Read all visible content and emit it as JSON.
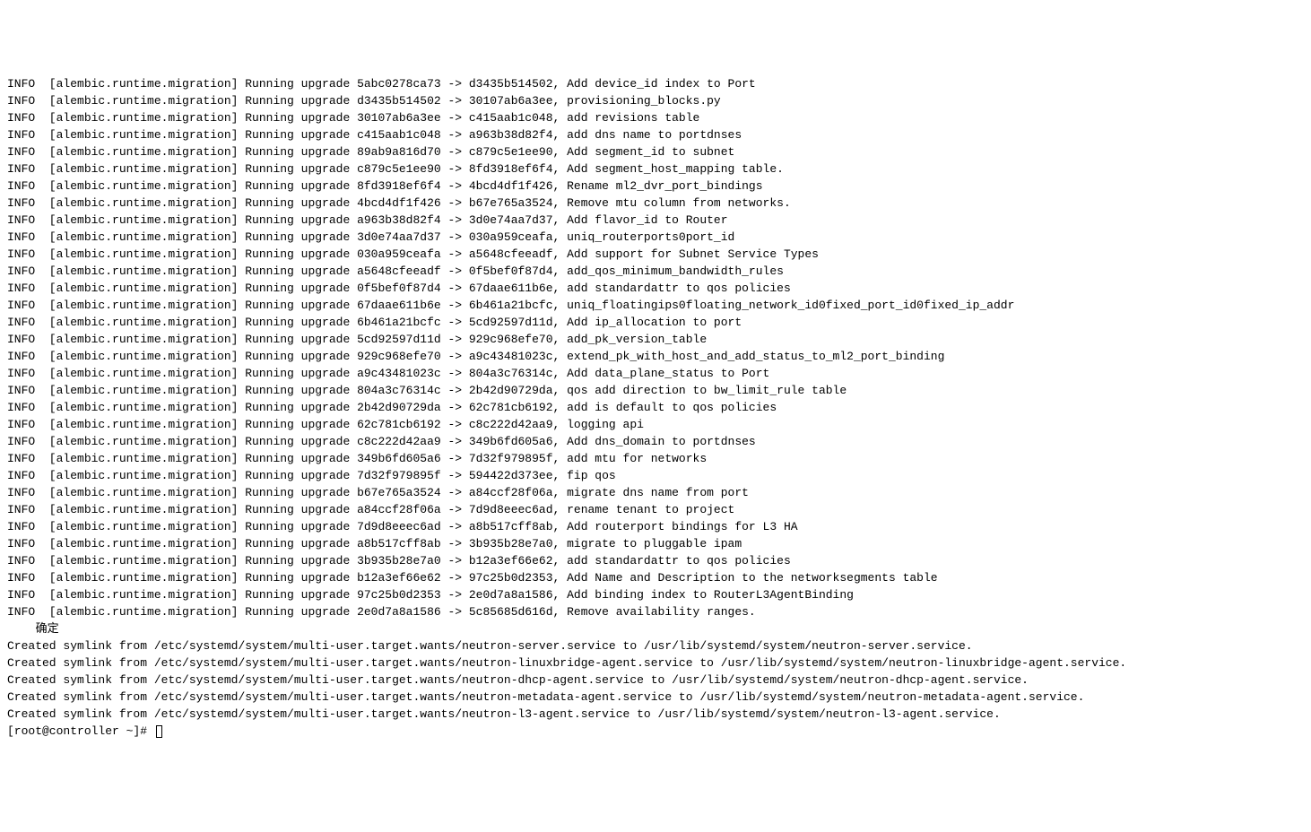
{
  "migrations": [
    {
      "from": "5abc0278ca73",
      "to": "d3435b514502",
      "desc": "Add device_id index to Port"
    },
    {
      "from": "d3435b514502",
      "to": "30107ab6a3ee",
      "desc": "provisioning_blocks.py"
    },
    {
      "from": "30107ab6a3ee",
      "to": "c415aab1c048",
      "desc": "add revisions table"
    },
    {
      "from": "c415aab1c048",
      "to": "a963b38d82f4",
      "desc": "add dns name to portdnses"
    },
    {
      "from": "89ab9a816d70",
      "to": "c879c5e1ee90",
      "desc": "Add segment_id to subnet"
    },
    {
      "from": "c879c5e1ee90",
      "to": "8fd3918ef6f4",
      "desc": "Add segment_host_mapping table."
    },
    {
      "from": "8fd3918ef6f4",
      "to": "4bcd4df1f426",
      "desc": "Rename ml2_dvr_port_bindings"
    },
    {
      "from": "4bcd4df1f426",
      "to": "b67e765a3524",
      "desc": "Remove mtu column from networks."
    },
    {
      "from": "a963b38d82f4",
      "to": "3d0e74aa7d37",
      "desc": "Add flavor_id to Router"
    },
    {
      "from": "3d0e74aa7d37",
      "to": "030a959ceafa",
      "desc": "uniq_routerports0port_id"
    },
    {
      "from": "030a959ceafa",
      "to": "a5648cfeeadf",
      "desc": "Add support for Subnet Service Types"
    },
    {
      "from": "a5648cfeeadf",
      "to": "0f5bef0f87d4",
      "desc": "add_qos_minimum_bandwidth_rules"
    },
    {
      "from": "0f5bef0f87d4",
      "to": "67daae611b6e",
      "desc": "add standardattr to qos policies"
    },
    {
      "from": "67daae611b6e",
      "to": "6b461a21bcfc",
      "desc": "uniq_floatingips0floating_network_id0fixed_port_id0fixed_ip_addr"
    },
    {
      "from": "6b461a21bcfc",
      "to": "5cd92597d11d",
      "desc": "Add ip_allocation to port"
    },
    {
      "from": "5cd92597d11d",
      "to": "929c968efe70",
      "desc": "add_pk_version_table"
    },
    {
      "from": "929c968efe70",
      "to": "a9c43481023c",
      "desc": "extend_pk_with_host_and_add_status_to_ml2_port_binding"
    },
    {
      "from": "a9c43481023c",
      "to": "804a3c76314c",
      "desc": "Add data_plane_status to Port"
    },
    {
      "from": "804a3c76314c",
      "to": "2b42d90729da",
      "desc": "qos add direction to bw_limit_rule table"
    },
    {
      "from": "2b42d90729da",
      "to": "62c781cb6192",
      "desc": "add is default to qos policies"
    },
    {
      "from": "62c781cb6192",
      "to": "c8c222d42aa9",
      "desc": "logging api"
    },
    {
      "from": "c8c222d42aa9",
      "to": "349b6fd605a6",
      "desc": "Add dns_domain to portdnses"
    },
    {
      "from": "349b6fd605a6",
      "to": "7d32f979895f",
      "desc": "add mtu for networks"
    },
    {
      "from": "7d32f979895f",
      "to": "594422d373ee",
      "desc": "fip qos"
    },
    {
      "from": "b67e765a3524",
      "to": "a84ccf28f06a",
      "desc": "migrate dns name from port"
    },
    {
      "from": "a84ccf28f06a",
      "to": "7d9d8eeec6ad",
      "desc": "rename tenant to project"
    },
    {
      "from": "7d9d8eeec6ad",
      "to": "a8b517cff8ab",
      "desc": "Add routerport bindings for L3 HA"
    },
    {
      "from": "a8b517cff8ab",
      "to": "3b935b28e7a0",
      "desc": "migrate to pluggable ipam"
    },
    {
      "from": "3b935b28e7a0",
      "to": "b12a3ef66e62",
      "desc": "add standardattr to qos policies"
    },
    {
      "from": "b12a3ef66e62",
      "to": "97c25b0d2353",
      "desc": "Add Name and Description to the networksegments table"
    },
    {
      "from": "97c25b0d2353",
      "to": "2e0d7a8a1586",
      "desc": "Add binding index to RouterL3AgentBinding"
    },
    {
      "from": "2e0d7a8a1586",
      "to": "5c85685d616d",
      "desc": "Remove availability ranges."
    }
  ],
  "log_level": "INFO",
  "log_source": "[alembic.runtime.migration]",
  "log_prefix": "Running upgrade",
  "status_label": "  确定",
  "symlinks": [
    {
      "from": "/etc/systemd/system/multi-user.target.wants/neutron-server.service",
      "to": "/usr/lib/systemd/system/neutron-server.service"
    },
    {
      "from": "/etc/systemd/system/multi-user.target.wants/neutron-linuxbridge-agent.service",
      "to": "/usr/lib/systemd/system/neutron-linuxbridge-agent.service"
    },
    {
      "from": "/etc/systemd/system/multi-user.target.wants/neutron-dhcp-agent.service",
      "to": "/usr/lib/systemd/system/neutron-dhcp-agent.service"
    },
    {
      "from": "/etc/systemd/system/multi-user.target.wants/neutron-metadata-agent.service",
      "to": "/usr/lib/systemd/system/neutron-metadata-agent.service"
    },
    {
      "from": "/etc/systemd/system/multi-user.target.wants/neutron-l3-agent.service",
      "to": "/usr/lib/systemd/system/neutron-l3-agent.service"
    }
  ],
  "symlink_prefix": "Created symlink from",
  "symlink_join": " to ",
  "prompt": "[root@controller ~]# "
}
